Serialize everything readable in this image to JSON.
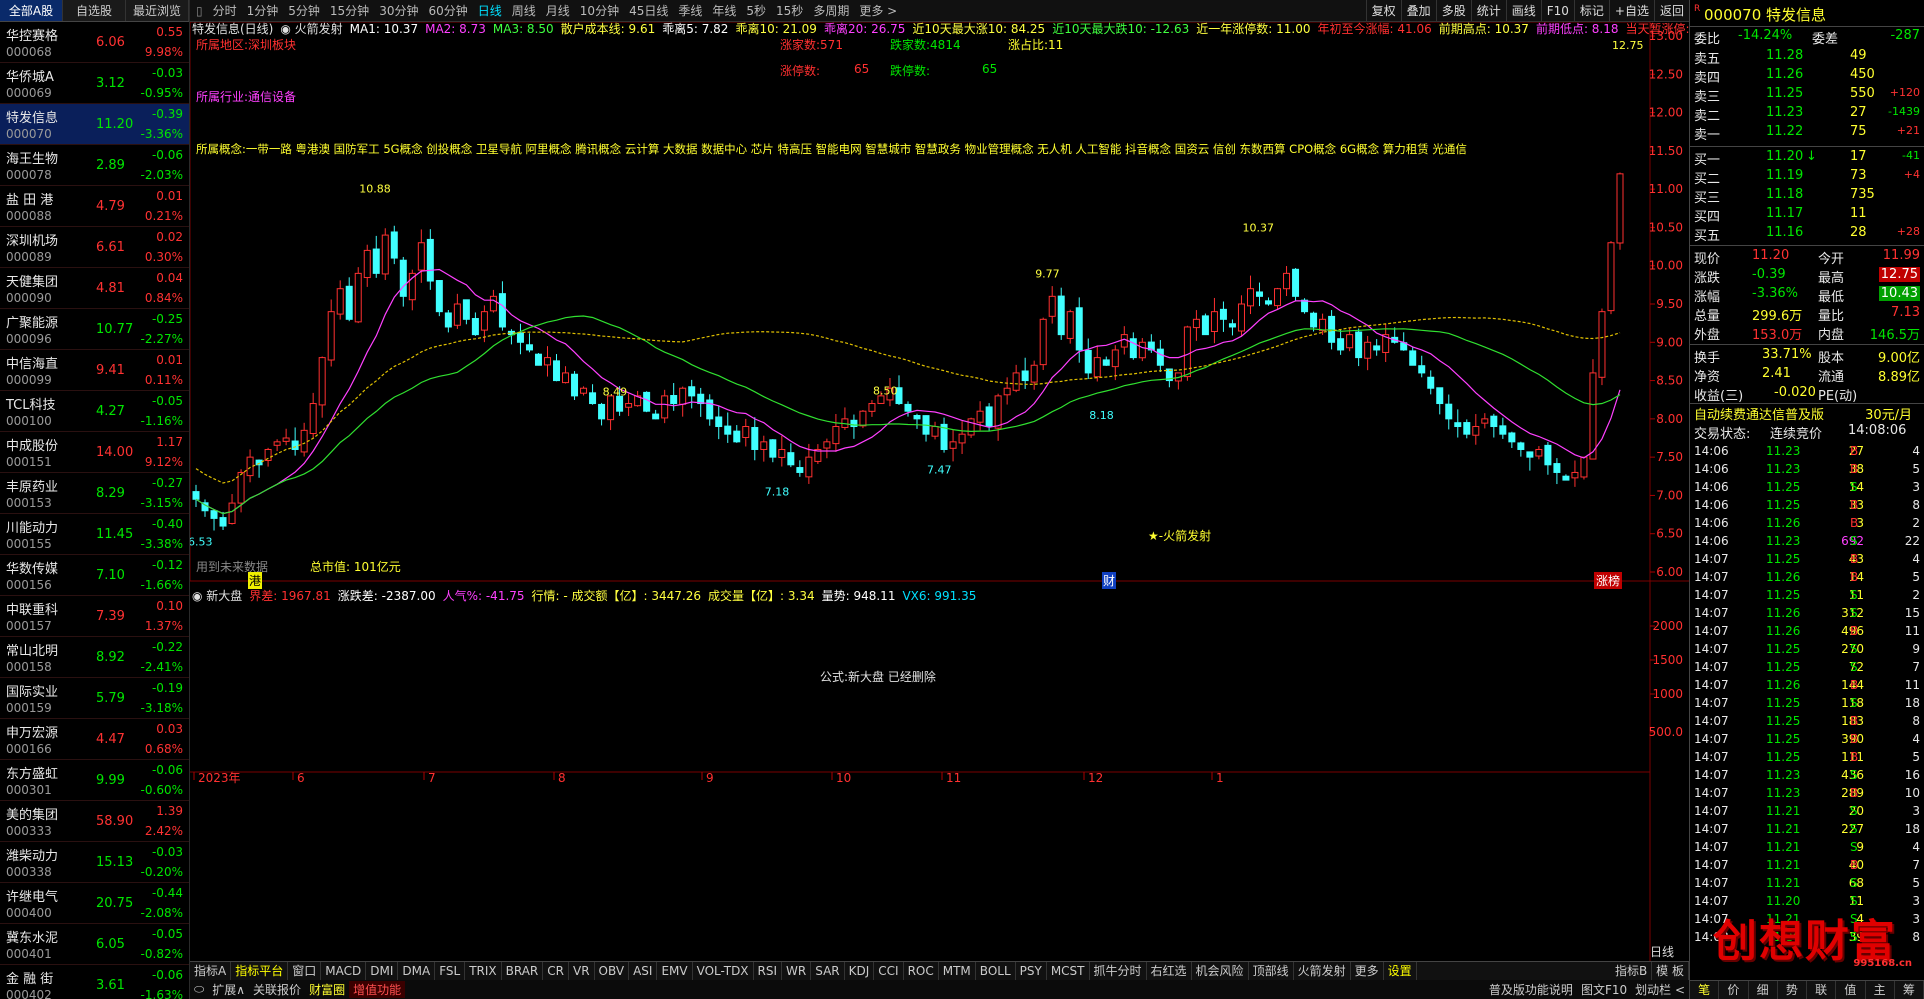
{
  "left_tabs": [
    "全部A股",
    "自选股",
    "最近浏览"
  ],
  "stocks": [
    {
      "name": "华控赛格",
      "code": "000068",
      "price": "6.06",
      "change": "0.55",
      "pct": "9.98%",
      "dir": "up"
    },
    {
      "name": "华侨城A",
      "code": "000069",
      "price": "3.12",
      "change": "-0.03",
      "pct": "-0.95%",
      "dir": "dn"
    },
    {
      "name": "特发信息",
      "code": "000070",
      "price": "11.20",
      "change": "-0.39",
      "pct": "-3.36%",
      "dir": "dn",
      "selected": true
    },
    {
      "name": "海王生物",
      "code": "000078",
      "price": "2.89",
      "change": "-0.06",
      "pct": "-2.03%",
      "dir": "dn"
    },
    {
      "name": "盐 田 港",
      "code": "000088",
      "price": "4.79",
      "change": "0.01",
      "pct": "0.21%",
      "dir": "up"
    },
    {
      "name": "深圳机场",
      "code": "000089",
      "price": "6.61",
      "change": "0.02",
      "pct": "0.30%",
      "dir": "up"
    },
    {
      "name": "天健集团",
      "code": "000090",
      "price": "4.81",
      "change": "0.04",
      "pct": "0.84%",
      "dir": "up"
    },
    {
      "name": "广聚能源",
      "code": "000096",
      "price": "10.77",
      "change": "-0.25",
      "pct": "-2.27%",
      "dir": "dn"
    },
    {
      "name": "中信海直",
      "code": "000099",
      "price": "9.41",
      "change": "0.01",
      "pct": "0.11%",
      "dir": "up"
    },
    {
      "name": "TCL科技",
      "code": "000100",
      "price": "4.27",
      "change": "-0.05",
      "pct": "-1.16%",
      "dir": "dn"
    },
    {
      "name": "中成股份",
      "code": "000151",
      "price": "14.00",
      "change": "1.17",
      "pct": "9.12%",
      "dir": "up"
    },
    {
      "name": "丰原药业",
      "code": "000153",
      "price": "8.29",
      "change": "-0.27",
      "pct": "-3.15%",
      "dir": "dn"
    },
    {
      "name": "川能动力",
      "code": "000155",
      "price": "11.45",
      "change": "-0.40",
      "pct": "-3.38%",
      "dir": "dn"
    },
    {
      "name": "华数传媒",
      "code": "000156",
      "price": "7.10",
      "change": "-0.12",
      "pct": "-1.66%",
      "dir": "dn"
    },
    {
      "name": "中联重科",
      "code": "000157",
      "price": "7.39",
      "change": "0.10",
      "pct": "1.37%",
      "dir": "up"
    },
    {
      "name": "常山北明",
      "code": "000158",
      "price": "8.92",
      "change": "-0.22",
      "pct": "-2.41%",
      "dir": "dn"
    },
    {
      "name": "国际实业",
      "code": "000159",
      "price": "5.79",
      "change": "-0.19",
      "pct": "-3.18%",
      "dir": "dn"
    },
    {
      "name": "申万宏源",
      "code": "000166",
      "price": "4.47",
      "change": "0.03",
      "pct": "0.68%",
      "dir": "up"
    },
    {
      "name": "东方盛虹",
      "code": "000301",
      "price": "9.99",
      "change": "-0.06",
      "pct": "-0.60%",
      "dir": "dn"
    },
    {
      "name": "美的集团",
      "code": "000333",
      "price": "58.90",
      "change": "1.39",
      "pct": "2.42%",
      "dir": "up"
    },
    {
      "name": "潍柴动力",
      "code": "000338",
      "price": "15.13",
      "change": "-0.03",
      "pct": "-0.20%",
      "dir": "dn"
    },
    {
      "name": "许继电气",
      "code": "000400",
      "price": "20.75",
      "change": "-0.44",
      "pct": "-2.08%",
      "dir": "dn"
    },
    {
      "name": "冀东水泥",
      "code": "000401",
      "price": "6.05",
      "change": "-0.05",
      "pct": "-0.82%",
      "dir": "dn"
    },
    {
      "name": "金 融 街",
      "code": "000402",
      "price": "3.61",
      "change": "-0.06",
      "pct": "-1.63%",
      "dir": "dn"
    }
  ],
  "toolbar": {
    "periods": [
      "分时",
      "1分钟",
      "5分钟",
      "15分钟",
      "30分钟",
      "60分钟",
      "日线",
      "周线",
      "月线",
      "10分钟",
      "45日线",
      "季线",
      "年线",
      "5秒",
      "15秒",
      "多周期",
      "更多 >"
    ],
    "active": "日线",
    "right": [
      "复权",
      "叠加",
      "多股",
      "统计",
      "画线",
      "F10",
      "标记",
      "+自选",
      "返回"
    ]
  },
  "chart": {
    "info_line": [
      {
        "t": "特发信息(日线)",
        "c": "#e0e0e0"
      },
      {
        "t": "◉ 火箭发射",
        "c": "#e0e0e0"
      },
      {
        "t": "MA1: 10.37",
        "c": "#ffffff"
      },
      {
        "t": "MA2: 8.73",
        "c": "#ff40ff"
      },
      {
        "t": "MA3: 8.50",
        "c": "#40ff40"
      },
      {
        "t": "散户成本线: 9.61",
        "c": "#ffff40"
      },
      {
        "t": "乖离5: 7.82",
        "c": "#ffffff"
      },
      {
        "t": "乖离10: 21.09",
        "c": "#ffff40"
      },
      {
        "t": "乖离20: 26.75",
        "c": "#ff40ff"
      },
      {
        "t": "近10天最大涨10: 84.25",
        "c": "#ffff40"
      },
      {
        "t": "近10天最大跌10: -12.63",
        "c": "#40ff40"
      },
      {
        "t": "近一年涨停数: 11.00",
        "c": "#ffff40"
      },
      {
        "t": "年初至今涨幅: 41.06",
        "c": "#ff3030"
      },
      {
        "t": "前期高点: 10.37",
        "c": "#ffff40"
      },
      {
        "t": "前期低点: 8.18",
        "c": "#ff40ff"
      },
      {
        "t": "当天暂涨停: 1.0",
        "c": "#ff3030"
      }
    ],
    "region": "所属地区:深圳板块",
    "industry": "所属行业:通信设备",
    "concepts": "所属概念:一带一路 粤港澳 国防军工 5G概念 创投概念 卫星导航 阿里概念 腾讯概念 云计算 大数据 数据中心 芯片 特高压 智能电网 智慧城市 智慧政务 物业管理概念 无人机 人工智能 抖音概念 国资云 信创 东数西算 CPO概念 6G概念 算力租赁 光通信",
    "stats": {
      "up_count": "涨家数:571",
      "down_count": "跌家数:4814",
      "ratio": "涨占比:11",
      "limit_up": "涨停数:",
      "limit_up_v": "65",
      "limit_down": "跌停数:",
      "limit_down_v": "65"
    },
    "signal": "★-火箭发射",
    "mcap": "总市值: 101亿元",
    "future": "用到未来数据",
    "badges": {
      "gang": "港",
      "cai": "财",
      "rank": "涨榜"
    },
    "y_axis": [
      "13.00",
      "12.50",
      "12.00",
      "11.50",
      "11.00",
      "10.50",
      "10.00",
      "9.50",
      "9.00",
      "8.50",
      "8.00",
      "7.50",
      "7.00",
      "6.50",
      "6.00"
    ],
    "lower_axis": [
      "2000",
      "1500",
      "1000",
      "500.0"
    ],
    "months": [
      "2023年",
      "6",
      "7",
      "8",
      "9",
      "10",
      "11",
      "12",
      "1"
    ],
    "period_box": "日线",
    "lower_info": [
      {
        "t": "◉ 新大盘",
        "c": "#e0e0e0"
      },
      {
        "t": "界差: 1967.81",
        "c": "#ff3030"
      },
      {
        "t": "涨跌差: -2387.00",
        "c": "#ffffff"
      },
      {
        "t": "人气%: -41.75",
        "c": "#ff40ff"
      },
      {
        "t": "行情: - 成交额【亿】: 3447.26",
        "c": "#ffff40"
      },
      {
        "t": "成交量【亿】: 3.34",
        "c": "#ffff40"
      },
      {
        "t": "量势: 948.11",
        "c": "#ffffff"
      },
      {
        "t": "VX6: 991.35",
        "c": "#00e0ff"
      }
    ],
    "deleted": "公式:新大盘 已经删除"
  },
  "chart_data": {
    "type": "candlestick",
    "title": "特发信息(日线)",
    "ylim": [
      6.0,
      13.0
    ],
    "annotated_points": [
      {
        "label": "10.88",
        "value": 10.88
      },
      {
        "label": "6.53",
        "value": 6.53
      },
      {
        "label": "8.49",
        "value": 8.49
      },
      {
        "label": "7.18",
        "value": 7.18
      },
      {
        "label": "8.50",
        "value": 8.5
      },
      {
        "label": "7.47",
        "value": 7.47
      },
      {
        "label": "9.77",
        "value": 9.77
      },
      {
        "label": "8.18",
        "value": 8.18
      },
      {
        "label": "10.37",
        "value": 10.37
      },
      {
        "label": "12.75",
        "value": 12.75
      }
    ],
    "closes": [
      6.95,
      6.8,
      6.7,
      6.6,
      6.9,
      7.3,
      7.5,
      7.4,
      7.6,
      7.7,
      7.75,
      7.6,
      7.85,
      8.2,
      8.8,
      9.4,
      9.7,
      9.3,
      9.9,
      10.2,
      9.9,
      10.4,
      10.1,
      9.6,
      9.9,
      10.3,
      9.8,
      9.4,
      9.2,
      9.5,
      9.3,
      9.1,
      9.4,
      9.6,
      9.2,
      9.1,
      9.0,
      8.9,
      8.7,
      8.8,
      8.5,
      8.6,
      8.3,
      8.4,
      8.2,
      8.0,
      8.3,
      8.1,
      8.2,
      8.3,
      8.1,
      8.0,
      8.3,
      8.2,
      8.4,
      8.3,
      8.2,
      8.0,
      7.9,
      7.8,
      7.7,
      7.9,
      7.6,
      7.7,
      7.5,
      7.6,
      7.4,
      7.3,
      7.5,
      7.6,
      7.7,
      7.9,
      8.0,
      7.9,
      8.1,
      8.2,
      8.3,
      8.4,
      8.2,
      8.1,
      8.0,
      7.8,
      7.9,
      7.6,
      7.7,
      7.8,
      8.0,
      8.1,
      7.9,
      8.3,
      8.4,
      8.6,
      8.5,
      8.7,
      9.3,
      9.6,
      9.1,
      9.4,
      8.9,
      8.6,
      8.8,
      8.7,
      8.9,
      9.1,
      8.8,
      9.0,
      8.9,
      8.7,
      8.5,
      8.6,
      9.2,
      9.3,
      9.1,
      9.4,
      9.3,
      9.2,
      9.5,
      9.7,
      9.6,
      9.5,
      9.7,
      9.9,
      9.6,
      9.4,
      9.2,
      9.3,
      9.0,
      8.9,
      9.1,
      8.8,
      9.0,
      8.9,
      9.1,
      9.0,
      8.9,
      8.7,
      8.6,
      8.4,
      8.2,
      8.0,
      7.9,
      7.8,
      7.9,
      8.0,
      7.9,
      7.8,
      7.7,
      7.6,
      7.5,
      7.6,
      7.4,
      7.3,
      7.2,
      7.3,
      7.5,
      8.6,
      9.4,
      10.3,
      11.2
    ]
  },
  "quote": {
    "title": "000070 特发信息",
    "webi": {
      "l1": "委比",
      "v1": "-14.24%",
      "l2": "委差",
      "v2": "-287"
    },
    "asks": [
      {
        "l": "卖五",
        "p": "11.28",
        "v": "49",
        "d": ""
      },
      {
        "l": "卖四",
        "p": "11.26",
        "v": "450",
        "d": ""
      },
      {
        "l": "卖三",
        "p": "11.25",
        "v": "550",
        "d": "+120"
      },
      {
        "l": "卖二",
        "p": "11.23",
        "v": "27",
        "d": "-1439"
      },
      {
        "l": "卖一",
        "p": "11.22",
        "v": "75",
        "d": "+21"
      }
    ],
    "bids": [
      {
        "l": "买一",
        "p": "11.20",
        "v": "17",
        "d": "-41",
        "arrow": "↓"
      },
      {
        "l": "买二",
        "p": "11.19",
        "v": "73",
        "d": "+4"
      },
      {
        "l": "买三",
        "p": "11.18",
        "v": "735",
        "d": ""
      },
      {
        "l": "买四",
        "p": "11.17",
        "v": "11",
        "d": ""
      },
      {
        "l": "买五",
        "p": "11.16",
        "v": "28",
        "d": "+28"
      }
    ],
    "fields": [
      {
        "l": "现价",
        "v": "11.20",
        "l2": "今开",
        "v2": "11.99",
        "c1": "up",
        "c2": "up"
      },
      {
        "l": "涨跌",
        "v": "-0.39",
        "l2": "最高",
        "v2": "12.75",
        "c1": "dn",
        "c2": "up",
        "b2": "r"
      },
      {
        "l": "涨幅",
        "v": "-3.36%",
        "l2": "最低",
        "v2": "10.43",
        "c1": "dn",
        "c2": "dn",
        "b2": "g"
      },
      {
        "l": "总量",
        "v": "299.6万",
        "l2": "量比",
        "v2": "7.13",
        "c1": "ylw",
        "c2": "up"
      },
      {
        "l": "外盘",
        "v": "153.0万",
        "l2": "内盘",
        "v2": "146.5万",
        "c1": "up",
        "c2": "dn"
      }
    ],
    "fields2": [
      {
        "l": "换手",
        "v": "33.71%",
        "l2": "股本",
        "v2": "9.00亿"
      },
      {
        "l": "净资",
        "v": "2.41",
        "l2": "流通",
        "v2": "8.89亿"
      },
      {
        "l": "收益(三)",
        "v": "-0.020",
        "l2": "PE(动)",
        "v2": ""
      }
    ],
    "promo": "自动续费通达信普及版",
    "promo_price": "30元/月",
    "status_label": "交易状态:",
    "status": "连续竞价",
    "status_time": "14:08:06",
    "ticks": [
      [
        "14:06",
        "11.23",
        "27",
        "B",
        "4",
        "w"
      ],
      [
        "14:06",
        "11.23",
        "38",
        "B",
        "5",
        "w"
      ],
      [
        "14:06",
        "11.25",
        "14",
        "S",
        "3",
        "w"
      ],
      [
        "14:06",
        "11.25",
        "33",
        "B",
        "8",
        "w"
      ],
      [
        "14:06",
        "11.26",
        "3",
        "B",
        "2",
        "w"
      ],
      [
        "14:06",
        "11.23",
        "692",
        "S",
        "22",
        "m"
      ],
      [
        "14:07",
        "11.25",
        "43",
        "B",
        "4",
        "w"
      ],
      [
        "14:07",
        "11.26",
        "14",
        "B",
        "5",
        "w"
      ],
      [
        "14:07",
        "11.25",
        "11",
        "S",
        "2",
        "w"
      ],
      [
        "14:07",
        "11.26",
        "312",
        "S",
        "15",
        "w"
      ],
      [
        "14:07",
        "11.26",
        "496",
        "B",
        "11",
        "w"
      ],
      [
        "14:07",
        "11.25",
        "270",
        "S",
        "9",
        "w"
      ],
      [
        "14:07",
        "11.25",
        "72",
        "S",
        "7",
        "w"
      ],
      [
        "14:07",
        "11.26",
        "144",
        "B",
        "11",
        "w"
      ],
      [
        "14:07",
        "11.25",
        "118",
        "S",
        "18",
        "w"
      ],
      [
        "14:07",
        "11.25",
        "183",
        "B",
        "8",
        "w"
      ],
      [
        "14:07",
        "11.25",
        "390",
        "B",
        "4",
        "w"
      ],
      [
        "14:07",
        "11.25",
        "111",
        "B",
        "5",
        "w"
      ],
      [
        "14:07",
        "11.23",
        "436",
        "S",
        "16",
        "w"
      ],
      [
        "14:07",
        "11.23",
        "289",
        "B",
        "10",
        "w"
      ],
      [
        "14:07",
        "11.21",
        "20",
        "S",
        "3",
        "w"
      ],
      [
        "14:07",
        "11.21",
        "227",
        "S",
        "18",
        "w"
      ],
      [
        "14:07",
        "11.21",
        "9",
        "S",
        "4",
        "w"
      ],
      [
        "14:07",
        "11.21",
        "40",
        "B",
        "7",
        "w"
      ],
      [
        "14:07",
        "11.21",
        "68",
        "S",
        "5",
        "w"
      ],
      [
        "14:07",
        "11.20",
        "11",
        "S",
        "3",
        "w"
      ],
      [
        "14:07",
        "11.21",
        "4",
        "S",
        "3",
        "w"
      ],
      [
        "14:08",
        "11.20",
        "39",
        "S",
        "8",
        "w"
      ]
    ],
    "tabs": [
      "笔",
      "价",
      "细",
      "势",
      "联",
      "值",
      "主",
      "筹"
    ],
    "logo": "创想财富",
    "logo_small": "995168.cn"
  },
  "bottom_tabs": [
    "指标A",
    "指标平台",
    "窗口",
    "MACD",
    "DMI",
    "DMA",
    "FSL",
    "TRIX",
    "BRAR",
    "CR",
    "VR",
    "OBV",
    "ASI",
    "EMV",
    "VOL-TDX",
    "RSI",
    "WR",
    "SAR",
    "KDJ",
    "CCI",
    "ROC",
    "MTM",
    "BOLL",
    "PSY",
    "MCST",
    "抓牛分时",
    "右红选",
    "机会风险",
    "顶部线",
    "火箭发射",
    "更多",
    "设置"
  ],
  "bottom_tabs_right": [
    "指标B",
    "模 板"
  ],
  "bottom_status": [
    "扩展∧",
    "关联报价",
    "财富圈",
    "增值功能"
  ],
  "bottom_status_right": [
    "普及版功能说明",
    "图文F10",
    "划动栏 <"
  ]
}
